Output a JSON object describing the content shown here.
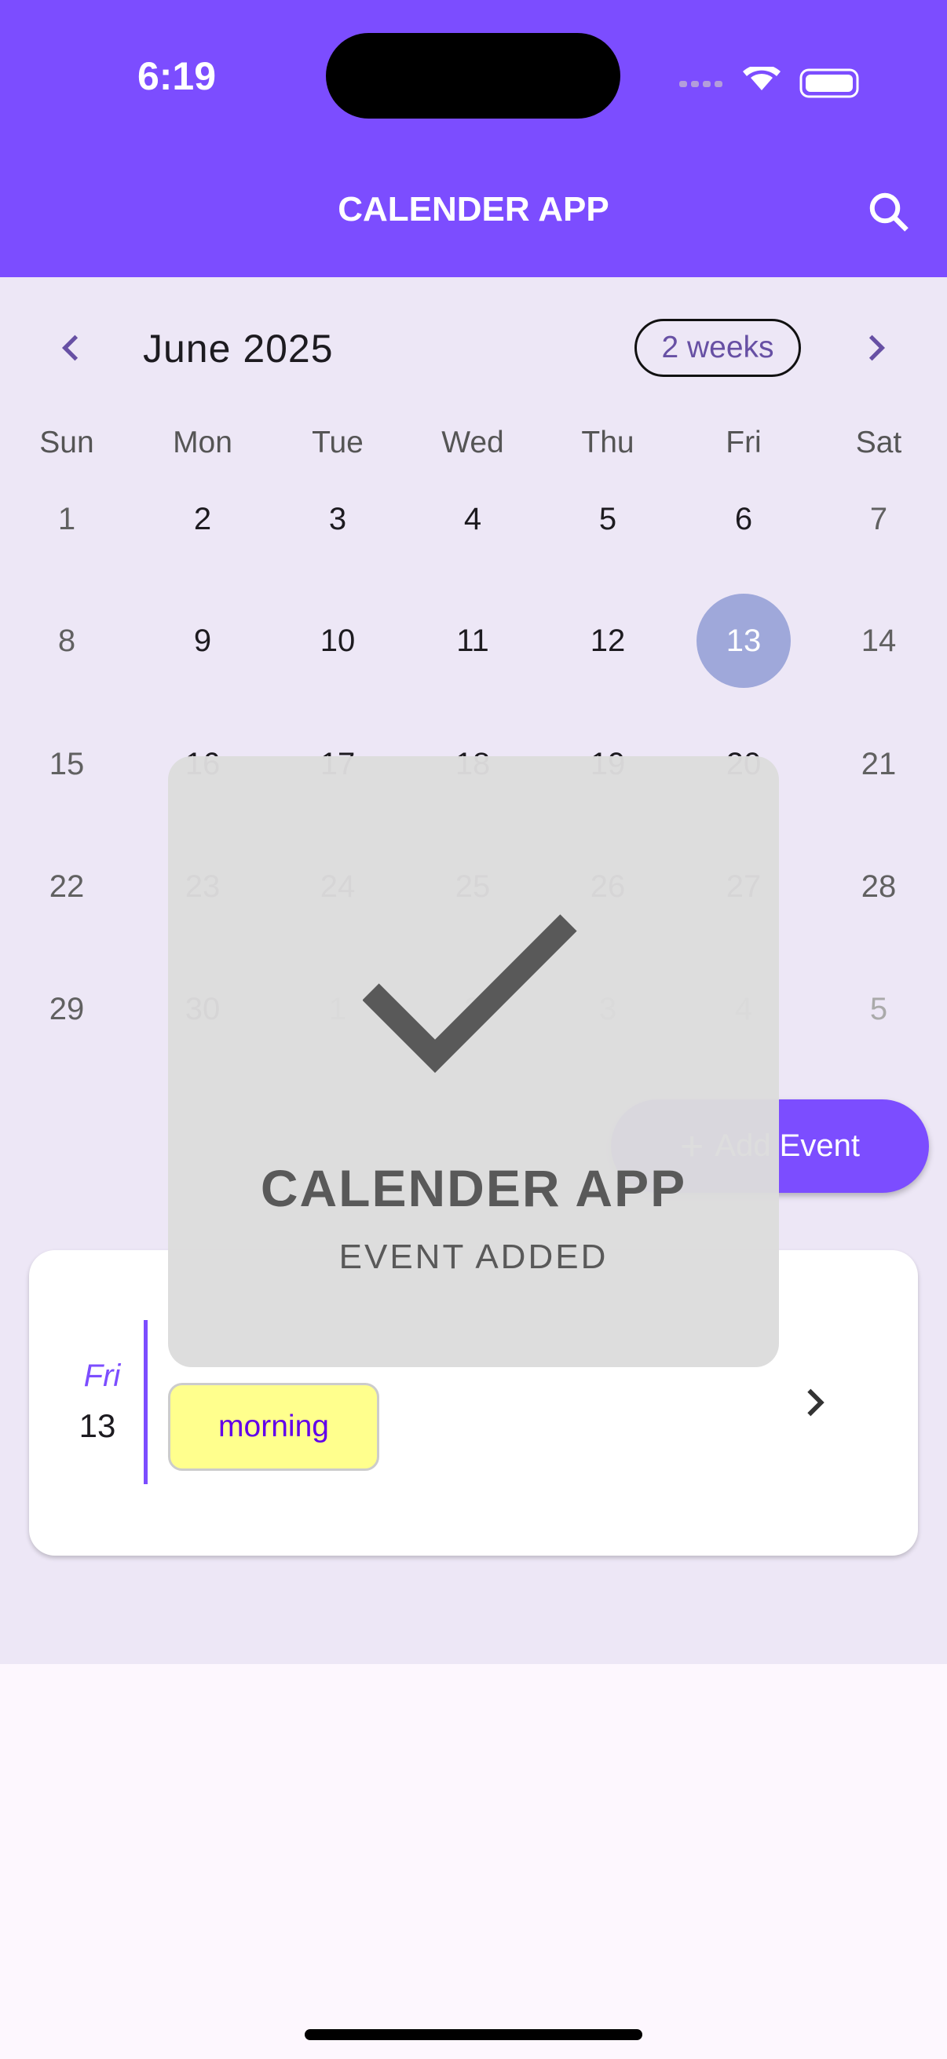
{
  "status_bar": {
    "time": "6:19"
  },
  "app_bar": {
    "title": "CALENDER APP",
    "search_icon": "search-icon"
  },
  "calendar": {
    "month_label": "June 2025",
    "format_button": "2 weeks",
    "weekdays": [
      "Sun",
      "Mon",
      "Tue",
      "Wed",
      "Thu",
      "Fri",
      "Sat"
    ],
    "weeks": [
      [
        "1",
        "2",
        "3",
        "4",
        "5",
        "6",
        "7"
      ],
      [
        "8",
        "9",
        "10",
        "11",
        "12",
        "13",
        "14"
      ],
      [
        "15",
        "16",
        "17",
        "18",
        "19",
        "20",
        "21"
      ],
      [
        "22",
        "23",
        "24",
        "25",
        "26",
        "27",
        "28"
      ],
      [
        "29",
        "30",
        "1",
        "2",
        "3",
        "4",
        "5"
      ]
    ],
    "selected_day": "13",
    "selected_color": "#9fa8da",
    "accent": "#7c4dff"
  },
  "fab": {
    "label": "Add Event",
    "icon": "plus-icon"
  },
  "event_card": {
    "day_name": "Fri",
    "day_number": "13",
    "event_label": "morning"
  },
  "toast": {
    "title": "CALENDER APP",
    "message": "EVENT ADDED",
    "icon": "check-icon"
  }
}
